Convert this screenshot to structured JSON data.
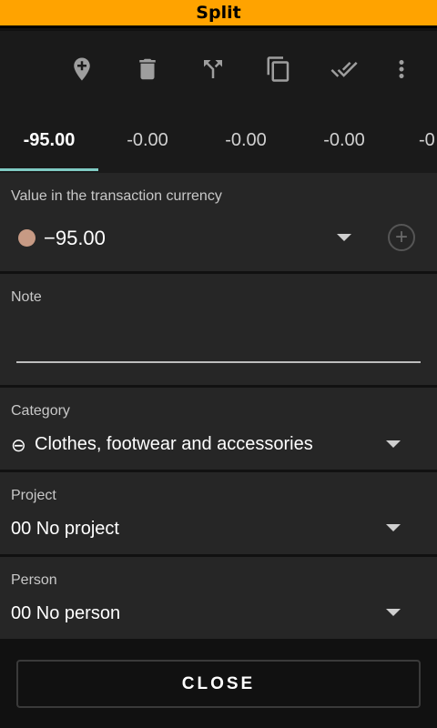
{
  "window": {
    "title": "Split"
  },
  "toolbar": {
    "icons": [
      "add-location-icon",
      "delete-icon",
      "split-icon",
      "copy-icon",
      "done-all-icon",
      "more-vert-icon"
    ]
  },
  "tabs": [
    {
      "label": "-95.00",
      "active": true
    },
    {
      "label": "-0.00",
      "active": false
    },
    {
      "label": "-0.00",
      "active": false
    },
    {
      "label": "-0.00",
      "active": false
    },
    {
      "label": "-0",
      "active": false
    }
  ],
  "value_section": {
    "label": "Value in the transaction currency",
    "amount": "−95.00",
    "dot_color": "#c79a84"
  },
  "note_section": {
    "label": "Note",
    "value": ""
  },
  "category_section": {
    "label": "Category",
    "prefix": "⊖",
    "value": "Clothes, footwear and accessories"
  },
  "project_section": {
    "label": "Project",
    "value": "00 No project"
  },
  "person_section": {
    "label": "Person",
    "value": "00 No person"
  },
  "close_button": {
    "label": "CLOSE"
  },
  "colors": {
    "title_bar": "#ffa300",
    "tab_indicator": "#80cbc4",
    "background": "#111111",
    "card": "#262626"
  }
}
